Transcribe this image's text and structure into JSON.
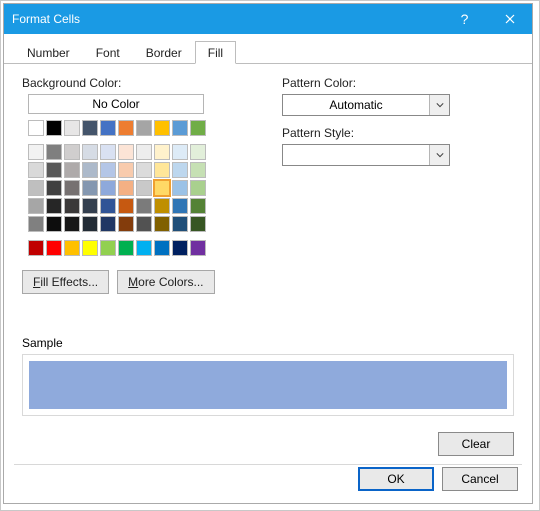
{
  "title": "Format Cells",
  "tabs": [
    "Number",
    "Font",
    "Border",
    "Fill"
  ],
  "active_tab": 3,
  "left": {
    "bg_label": "Background Color:",
    "no_color": "No Color",
    "fill_effects_prefix": "F",
    "fill_effects_rest": "ill Effects...",
    "more_colors_prefix": "M",
    "more_colors_rest": "ore Colors..."
  },
  "right": {
    "pattern_color_label": "Pattern Color:",
    "pattern_color_value": "Automatic",
    "pattern_style_label": "Pattern Style:",
    "pattern_style_value": ""
  },
  "sample_label": "Sample",
  "sample_color": "#8faadc",
  "clear_label": "Clear",
  "ok_label": "OK",
  "cancel_label": "Cancel",
  "palette_theme": [
    "#ffffff",
    "#000000",
    "#e7e6e6",
    "#44546a",
    "#4472c4",
    "#ed7d31",
    "#a5a5a5",
    "#ffc000",
    "#5b9bd5",
    "#70ad47"
  ],
  "palette_shades": [
    "#f2f2f2",
    "#7f7f7f",
    "#d0cece",
    "#d6dce5",
    "#d9e1f2",
    "#fce4d6",
    "#ededed",
    "#fff2cc",
    "#ddebf7",
    "#e2efda",
    "#d9d9d9",
    "#595959",
    "#aeaaaa",
    "#acb9ca",
    "#b4c6e7",
    "#f8cbad",
    "#dbdbdb",
    "#ffe699",
    "#bdd7ee",
    "#c6e0b4",
    "#bfbfbf",
    "#404040",
    "#767171",
    "#8497b0",
    "#8ea9db",
    "#f4b084",
    "#c9c9c9",
    "#ffd966",
    "#9bc2e6",
    "#a9d08e",
    "#a6a6a6",
    "#262626",
    "#3a3838",
    "#333f4f",
    "#305496",
    "#c65911",
    "#7b7b7b",
    "#bf8f00",
    "#2f75b5",
    "#548235",
    "#808080",
    "#0d0d0d",
    "#161616",
    "#222b35",
    "#203764",
    "#833c0c",
    "#525252",
    "#806000",
    "#1f4e78",
    "#375623"
  ],
  "palette_standard": [
    "#c00000",
    "#ff0000",
    "#ffc000",
    "#ffff00",
    "#92d050",
    "#00b050",
    "#00b0f0",
    "#0070c0",
    "#002060",
    "#7030a0"
  ],
  "selected_swatch": {
    "group": "shades",
    "index": 27
  }
}
